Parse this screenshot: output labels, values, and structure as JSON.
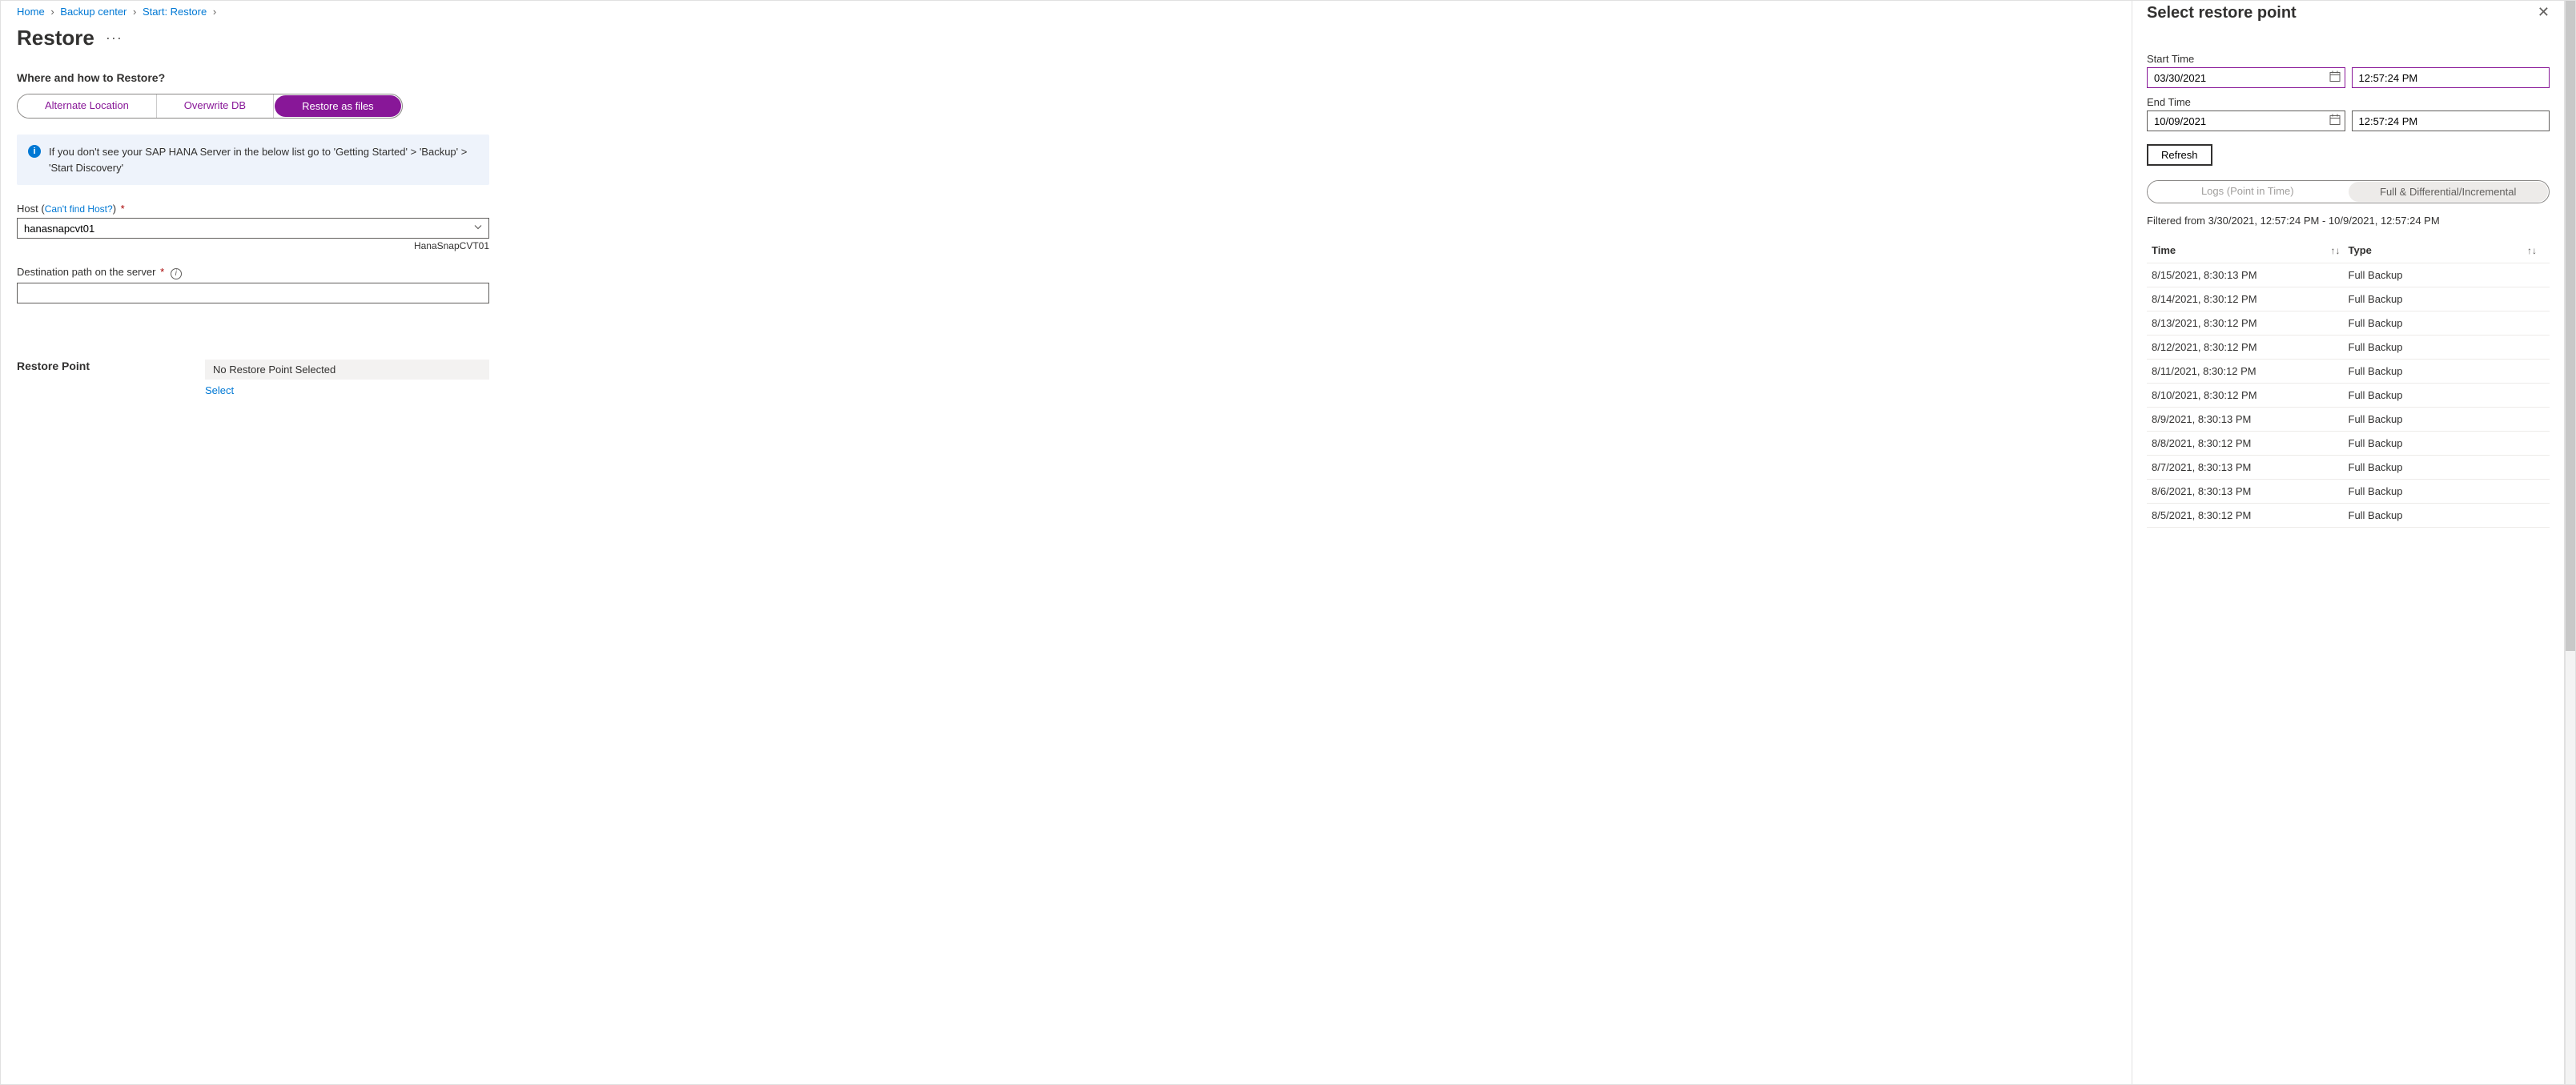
{
  "breadcrumb": {
    "items": [
      "Home",
      "Backup center",
      "Start: Restore"
    ]
  },
  "page_title": "Restore",
  "section_heading": "Where and how to Restore?",
  "pills": {
    "alt": "Alternate Location",
    "overwrite": "Overwrite DB",
    "files": "Restore as files"
  },
  "info_box": "If you don't see your SAP HANA Server in the below list go to 'Getting Started' > 'Backup' > 'Start Discovery'",
  "host": {
    "label": "Host",
    "help_link": "Can't find Host?",
    "value": "hanasnapcvt01",
    "helper": "HanaSnapCVT01"
  },
  "dest_path": {
    "label": "Destination path on the server",
    "value": ""
  },
  "restore_point": {
    "label": "Restore Point",
    "value": "No Restore Point Selected",
    "select_link": "Select"
  },
  "panel": {
    "title": "Select restore point",
    "start_label": "Start Time",
    "end_label": "End Time",
    "start_date": "03/30/2021",
    "start_time": "12:57:24 PM",
    "end_date": "10/09/2021",
    "end_time": "12:57:24 PM",
    "refresh": "Refresh",
    "toggle_logs": "Logs (Point in Time)",
    "toggle_full": "Full & Differential/Incremental",
    "filter_text": "Filtered from 3/30/2021, 12:57:24 PM - 10/9/2021, 12:57:24 PM",
    "col_time": "Time",
    "col_type": "Type",
    "rows": [
      {
        "time": "8/15/2021, 8:30:13 PM",
        "type": "Full Backup"
      },
      {
        "time": "8/14/2021, 8:30:12 PM",
        "type": "Full Backup"
      },
      {
        "time": "8/13/2021, 8:30:12 PM",
        "type": "Full Backup"
      },
      {
        "time": "8/12/2021, 8:30:12 PM",
        "type": "Full Backup"
      },
      {
        "time": "8/11/2021, 8:30:12 PM",
        "type": "Full Backup"
      },
      {
        "time": "8/10/2021, 8:30:12 PM",
        "type": "Full Backup"
      },
      {
        "time": "8/9/2021, 8:30:13 PM",
        "type": "Full Backup"
      },
      {
        "time": "8/8/2021, 8:30:12 PM",
        "type": "Full Backup"
      },
      {
        "time": "8/7/2021, 8:30:13 PM",
        "type": "Full Backup"
      },
      {
        "time": "8/6/2021, 8:30:13 PM",
        "type": "Full Backup"
      },
      {
        "time": "8/5/2021, 8:30:12 PM",
        "type": "Full Backup"
      }
    ]
  }
}
